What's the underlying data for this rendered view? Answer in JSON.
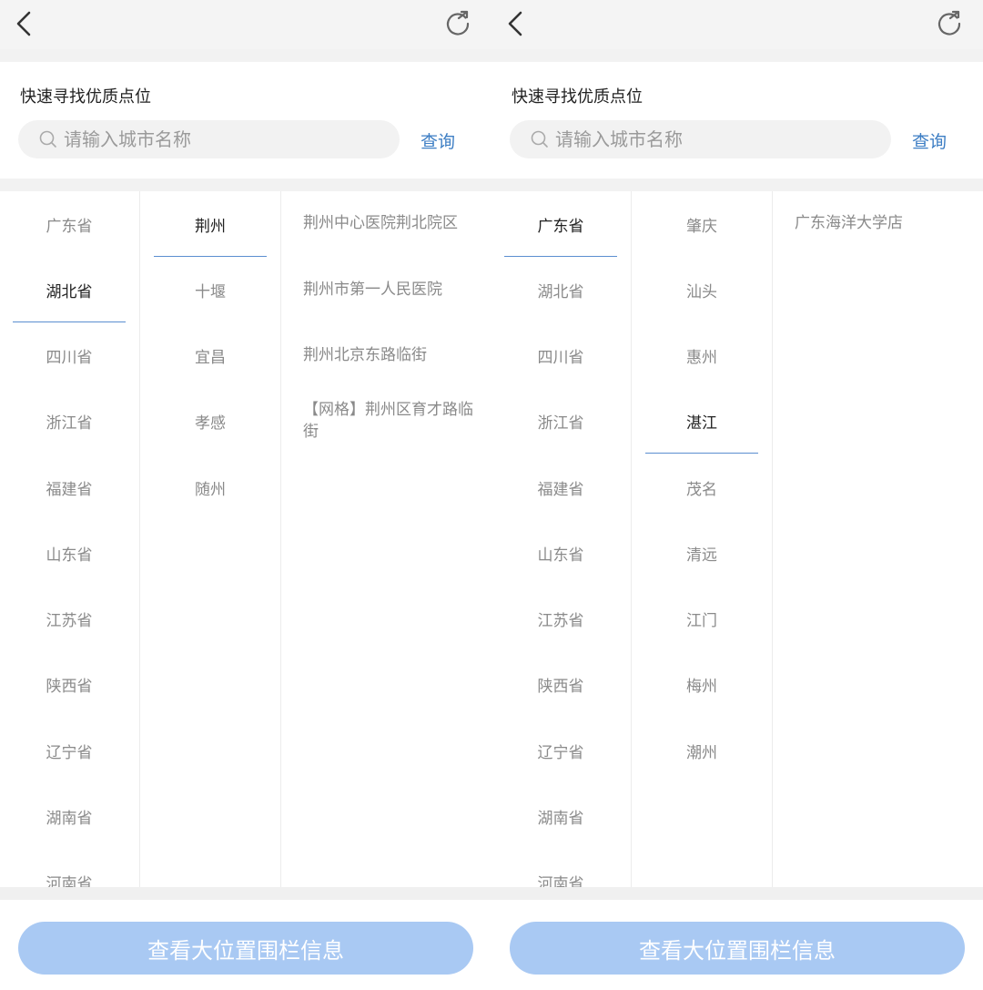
{
  "screens": [
    {
      "header": {
        "back_icon": "chevron-left-icon",
        "refresh_icon": "refresh-icon"
      },
      "search": {
        "title": "快速寻找优质点位",
        "placeholder": "请输入城市名称",
        "value": "",
        "query_label": "查询",
        "icon": "search-icon"
      },
      "provinces": [
        "广东省",
        "湖北省",
        "四川省",
        "浙江省",
        "福建省",
        "山东省",
        "江苏省",
        "陕西省",
        "辽宁省",
        "湖南省",
        "河南省"
      ],
      "selected_province": "湖北省",
      "cities": [
        "荆州",
        "十堰",
        "宜昌",
        "孝感",
        "随州"
      ],
      "selected_city": "荆州",
      "locations": [
        "荆州中心医院荆北院区",
        "荆州市第一人民医院",
        "荆州北京东路临街",
        "【网格】荆州区育才路临街"
      ],
      "fence_button_label": "查看大位置围栏信息"
    },
    {
      "header": {
        "back_icon": "chevron-left-icon",
        "refresh_icon": "refresh-icon"
      },
      "search": {
        "title": "快速寻找优质点位",
        "placeholder": "请输入城市名称",
        "value": "",
        "query_label": "查询",
        "icon": "search-icon"
      },
      "provinces": [
        "广东省",
        "湖北省",
        "四川省",
        "浙江省",
        "福建省",
        "山东省",
        "江苏省",
        "陕西省",
        "辽宁省",
        "湖南省",
        "河南省"
      ],
      "selected_province": "广东省",
      "cities": [
        "肇庆",
        "汕头",
        "惠州",
        "湛江",
        "茂名",
        "清远",
        "江门",
        "梅州",
        "潮州"
      ],
      "selected_city": "湛江",
      "locations": [
        "广东海洋大学店"
      ],
      "fence_button_label": "查看大位置围栏信息"
    }
  ],
  "colors": {
    "accent": "#3d7ec4",
    "underline": "#5b8fd0",
    "button_bg": "#a9c9f3",
    "muted_text": "#8a8a8a"
  }
}
